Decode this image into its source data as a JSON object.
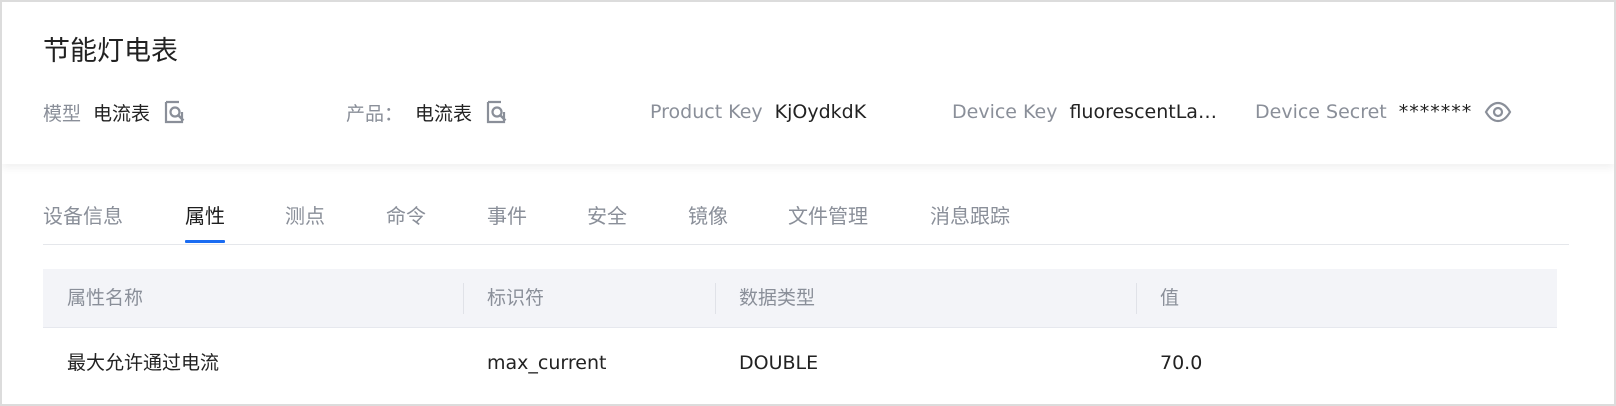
{
  "header": {
    "title": "节能灯电表",
    "model": {
      "label": "模型",
      "value": "电流表",
      "icon": "search-doc-icon"
    },
    "product": {
      "label": "产品：",
      "value": "电流表",
      "icon": "search-doc-icon"
    },
    "product_key": {
      "label": "Product Key",
      "value": "KjOydkdK"
    },
    "device_key": {
      "label": "Device Key",
      "value": "fluorescentLa…"
    },
    "device_secret": {
      "label": "Device Secret",
      "value": "*******",
      "icon": "eye-icon"
    }
  },
  "tabs": [
    {
      "label": "设备信息",
      "active": false
    },
    {
      "label": "属性",
      "active": true
    },
    {
      "label": "测点",
      "active": false
    },
    {
      "label": "命令",
      "active": false
    },
    {
      "label": "事件",
      "active": false
    },
    {
      "label": "安全",
      "active": false
    },
    {
      "label": "镜像",
      "active": false
    },
    {
      "label": "文件管理",
      "active": false
    },
    {
      "label": "消息跟踪",
      "active": false
    }
  ],
  "table": {
    "columns": [
      "属性名称",
      "标识符",
      "数据类型",
      "值"
    ],
    "rows": [
      [
        "最大允许通过电流",
        "max_current",
        "DOUBLE",
        "70.0"
      ]
    ]
  },
  "colors": {
    "accent": "#1a6cf2",
    "muted_text": "#8a8f99",
    "header_bg": "#f3f4f8"
  }
}
